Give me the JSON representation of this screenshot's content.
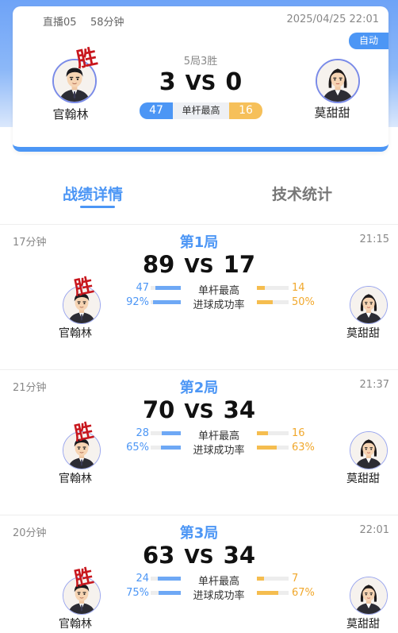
{
  "colors": {
    "blue": "#4c96f5",
    "orange": "#f6c05a",
    "winner_red": "#c8161d"
  },
  "header": {
    "room": "直播05",
    "duration": "58分钟",
    "datetime": "2025/04/25 22:01",
    "auto_badge": "自动",
    "format": "5局3胜",
    "score_left": "3",
    "vs": "VS",
    "score_right": "0",
    "win_mark": "胜",
    "player_left": "官翰林",
    "player_right": "莫甜甜",
    "best_break_left": "47",
    "best_break_label": "单杆最高",
    "best_break_right": "16"
  },
  "tabs": [
    {
      "label": "战绩详情",
      "active": true
    },
    {
      "label": "技术统计",
      "active": false
    }
  ],
  "games": [
    {
      "title": "第1局",
      "duration": "17分钟",
      "time": "21:15",
      "score_left": "89",
      "vs": "VS",
      "score_right": "17",
      "win_mark": "胜",
      "player_left": "官翰林",
      "player_right": "莫甜甜",
      "stats": [
        {
          "label": "单杆最高",
          "left": "47",
          "right": "14",
          "left_fill": 0.85,
          "right_fill": 0.25
        },
        {
          "label": "进球成功率",
          "left": "92%",
          "right": "50%",
          "left_fill": 0.92,
          "right_fill": 0.5
        }
      ]
    },
    {
      "title": "第2局",
      "duration": "21分钟",
      "time": "21:37",
      "score_left": "70",
      "vs": "VS",
      "score_right": "34",
      "win_mark": "胜",
      "player_left": "官翰林",
      "player_right": "莫甜甜",
      "stats": [
        {
          "label": "单杆最高",
          "left": "28",
          "right": "16",
          "left_fill": 0.64,
          "right_fill": 0.36
        },
        {
          "label": "进球成功率",
          "left": "65%",
          "right": "63%",
          "left_fill": 0.65,
          "right_fill": 0.63
        }
      ]
    },
    {
      "title": "第3局",
      "duration": "20分钟",
      "time": "22:01",
      "score_left": "63",
      "vs": "VS",
      "score_right": "34",
      "win_mark": "胜",
      "player_left": "官翰林",
      "player_right": "莫甜甜",
      "stats": [
        {
          "label": "单杆最高",
          "left": "24",
          "right": "7",
          "left_fill": 0.77,
          "right_fill": 0.23
        },
        {
          "label": "进球成功率",
          "left": "75%",
          "right": "67%",
          "left_fill": 0.75,
          "right_fill": 0.67
        }
      ]
    }
  ]
}
